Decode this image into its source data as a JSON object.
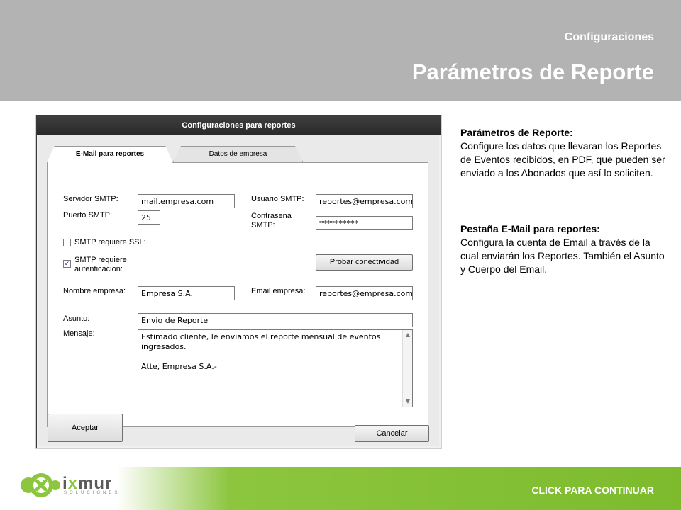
{
  "header": {
    "subtitle": "Configuraciones",
    "title": "Parámetros de Reporte"
  },
  "dialog": {
    "title": "Configuraciones para reportes",
    "tabs": [
      {
        "label": "E-Mail para reportes",
        "active": true
      },
      {
        "label": "Datos de empresa",
        "active": false
      }
    ],
    "smtp_server_label": "Servidor SMTP:",
    "smtp_server_value": "mail.empresa.com",
    "smtp_port_label": "Puerto SMTP:",
    "smtp_port_value": "25",
    "smtp_user_label": "Usuario SMTP:",
    "smtp_user_value": "reportes@empresa.com",
    "smtp_password_label": "Contrasena SMTP:",
    "smtp_password_value": "**********",
    "ssl_label": "SMTP requiere SSL:",
    "ssl_checked": false,
    "auth_label": "SMTP requiere autenticacion:",
    "auth_checked": true,
    "test_button": "Probar conectividad",
    "company_name_label": "Nombre empresa:",
    "company_name_value": "Empresa S.A.",
    "company_email_label": "Email empresa:",
    "company_email_value": "reportes@empresa.com",
    "subject_label": "Asunto:",
    "subject_value": "Envio de Reporte",
    "message_label": "Mensaje:",
    "message_line1": "Estimado cliente, le enviamos el reporte mensual de eventos",
    "message_line2": "ingresados.",
    "message_line3": "Atte, Empresa S.A.-",
    "accept_button": "Aceptar",
    "cancel_button": "Cancelar"
  },
  "description": {
    "section1_title": "Parámetros de Reporte:",
    "section1_text": "Configure los datos que llevaran los Reportes de Eventos recibidos, en PDF, que pueden ser enviado a los Abonados que así lo soliciten.",
    "section2_title": "Pestaña E-Mail para reportes:",
    "section2_text": "Configura la cuenta de Email a través de la cual enviarán los Reportes. También el Asunto y Cuerpo del Email."
  },
  "footer": {
    "cta": "CLICK PARA CONTINUAR",
    "logo_text_a": "i",
    "logo_text_x": "x",
    "logo_text_b": "mur",
    "logo_sub": "SOLUCIONES",
    "brand_green": "#8cc63f"
  }
}
